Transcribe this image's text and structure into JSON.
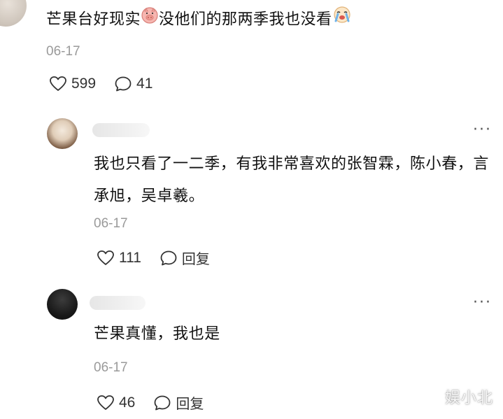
{
  "main_comment": {
    "text_part1": "芒果台好现实",
    "text_part2": "没他们的那两季我也没看",
    "emoji1": "pig-emoji",
    "emoji2": "crying-face-emoji",
    "date": "06-17",
    "likes": "599",
    "comments": "41"
  },
  "replies": [
    {
      "text": "我也只看了一二季，有我非常喜欢的张智霖，陈小春，言承旭，吴卓羲。",
      "date": "06-17",
      "likes": "111",
      "reply_label": "回复",
      "more": "···"
    },
    {
      "text": "芒果真懂，我也是",
      "date": "06-17",
      "likes": "46",
      "reply_label": "回复",
      "more": "···"
    }
  ],
  "watermark": "娱小北",
  "colors": {
    "text": "#111111",
    "muted": "#9a9a9a",
    "icon": "#333333"
  }
}
